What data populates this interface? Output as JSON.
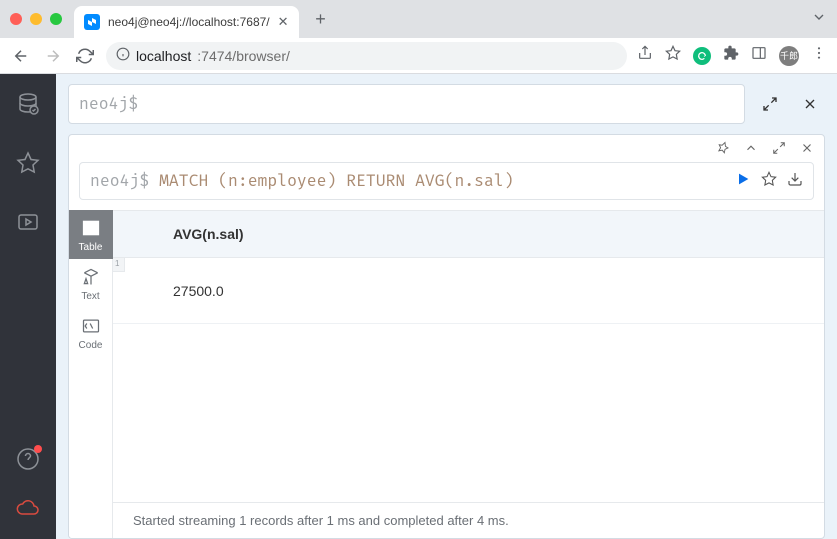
{
  "browser": {
    "tab_title": "neo4j@neo4j://localhost:7687/",
    "url_host": "localhost",
    "url_port_path": ":7474/browser/",
    "avatar_text": "千郎"
  },
  "sidebar": {
    "items": [
      "database",
      "favorites",
      "guides"
    ],
    "bottom": [
      "help",
      "cloud"
    ]
  },
  "editor": {
    "prompt": "neo4j$ ",
    "value": ""
  },
  "result": {
    "prompt": "neo4j$",
    "query": "MATCH (n:employee) RETURN AVG(n.sal)",
    "viewmodes": [
      {
        "key": "table",
        "label": "Table",
        "active": true
      },
      {
        "key": "text",
        "label": "Text",
        "active": false
      },
      {
        "key": "code",
        "label": "Code",
        "active": false
      }
    ],
    "table": {
      "columns": [
        "AVG(n.sal)"
      ],
      "rows": [
        {
          "n": "1",
          "cells": [
            "27500.0"
          ]
        }
      ]
    },
    "status": "Started streaming 1 records after 1 ms and completed after 4 ms."
  }
}
